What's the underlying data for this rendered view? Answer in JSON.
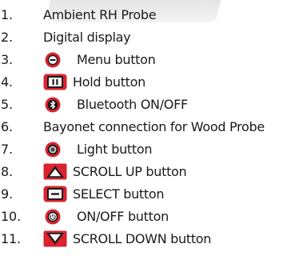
{
  "items": [
    {
      "number": "1.",
      "label": "Ambient RH Probe",
      "icon": "none"
    },
    {
      "number": "2.",
      "label": "Digital display",
      "icon": "none"
    },
    {
      "number": "3.",
      "label": "Menu button",
      "icon": "menu-button-icon"
    },
    {
      "number": "4.",
      "label": "Hold button",
      "icon": "hold-button-icon"
    },
    {
      "number": "5.",
      "label": "Bluetooth ON/OFF",
      "icon": "bluetooth-button-icon"
    },
    {
      "number": "6.",
      "label": "Bayonet connection for Wood Probe",
      "icon": "none"
    },
    {
      "number": "7.",
      "label": "Light button",
      "icon": "light-button-icon"
    },
    {
      "number": "8.",
      "label": "SCROLL UP button",
      "icon": "scroll-up-button-icon"
    },
    {
      "number": "9.",
      "label": "SELECT button",
      "icon": "select-button-icon"
    },
    {
      "number": "10.",
      "label": "ON/OFF button",
      "icon": "power-button-icon"
    },
    {
      "number": "11.",
      "label": "SCROLL DOWN button",
      "icon": "scroll-down-button-icon"
    }
  ],
  "colors": {
    "accent_red": "#d9232e",
    "text": "#1a1a1a",
    "probe_gray": "#e6e6e6"
  }
}
